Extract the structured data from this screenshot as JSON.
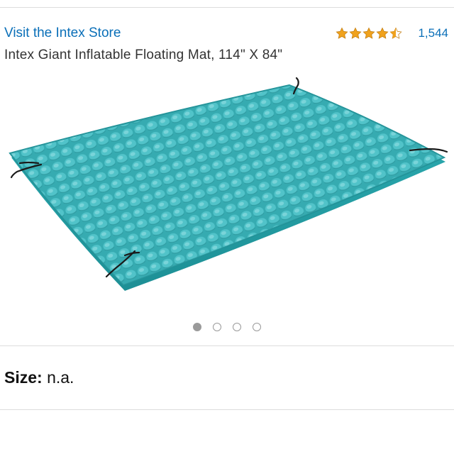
{
  "store": {
    "link_text": "Visit the Intex Store"
  },
  "rating": {
    "stars": 4.5,
    "count": "1,544",
    "star_color": "#f0a21d"
  },
  "product": {
    "title": "Intex Giant Inflatable Floating Mat, 114\" X 84\"",
    "mat_color": "#35b2b8"
  },
  "carousel": {
    "total": 4,
    "active": 1
  },
  "size": {
    "label": "Size:",
    "value": "n.a."
  }
}
